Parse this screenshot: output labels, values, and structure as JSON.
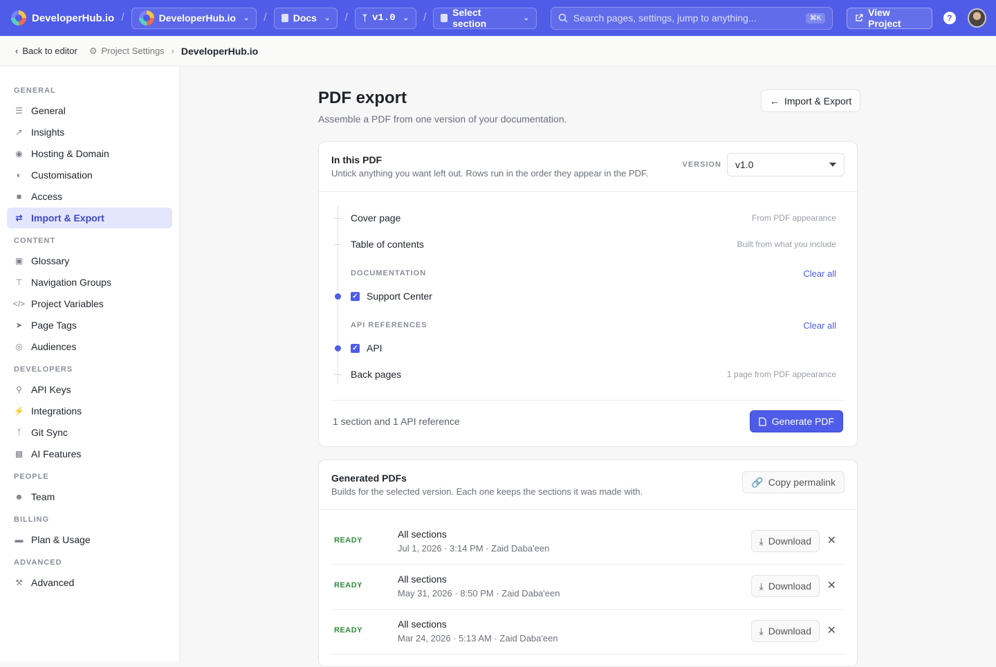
{
  "topbar": {
    "brand": "DeveloperHub.io",
    "project": "DeveloperHub.io",
    "docs": "Docs",
    "version": "v1.0",
    "section": "Select section",
    "search_placeholder": "Search pages, settings, jump to anything...",
    "search_shortcut": "⌘K",
    "view_project": "View Project",
    "help": "?"
  },
  "breadcrumb": {
    "back": "Back to editor",
    "settings": "Project Settings",
    "current": "DeveloperHub.io"
  },
  "sidebar": {
    "groups": [
      {
        "title": "GENERAL",
        "items": [
          "General",
          "Insights",
          "Hosting & Domain",
          "Customisation",
          "Access",
          "Import & Export"
        ]
      },
      {
        "title": "CONTENT",
        "items": [
          "Glossary",
          "Navigation Groups",
          "Project Variables",
          "Page Tags",
          "Audiences"
        ]
      },
      {
        "title": "DEVELOPERS",
        "items": [
          "API Keys",
          "Integrations",
          "Git Sync",
          "AI Features"
        ]
      },
      {
        "title": "PEOPLE",
        "items": [
          "Team"
        ]
      },
      {
        "title": "BILLING",
        "items": [
          "Plan & Usage"
        ]
      },
      {
        "title": "ADVANCED",
        "items": [
          "Advanced"
        ]
      }
    ],
    "active": "Import & Export"
  },
  "page": {
    "title": "PDF export",
    "subtitle": "Assemble a PDF from one version of your documentation.",
    "back_button": "Import & Export"
  },
  "in_pdf": {
    "title": "In this PDF",
    "description": "Untick anything you want left out. Rows run in the order they appear in the PDF.",
    "version_label": "VERSION",
    "version_value": "v1.0",
    "cover_page": "Cover page",
    "cover_note": "From PDF appearance",
    "toc": "Table of contents",
    "toc_note": "Built from what you include",
    "documentation_label": "DOCUMENTATION",
    "clear_all": "Clear all",
    "doc_item": "Support Center",
    "api_label": "API REFERENCES",
    "api_item": "API",
    "back_pages": "Back pages",
    "back_note": "1 page from PDF appearance",
    "summary": "1 section and 1 API reference",
    "generate": "Generate PDF"
  },
  "generated": {
    "title": "Generated PDFs",
    "description": "Builds for the selected version. Each one keeps the sections it was made with.",
    "permalink": "Copy permalink",
    "download": "Download",
    "rows": [
      {
        "status": "READY",
        "title": "All sections",
        "meta": "Jul 1, 2026 · 3:14 PM · Zaid Daba'een"
      },
      {
        "status": "READY",
        "title": "All sections",
        "meta": "May 31, 2026 · 8:50 PM · Zaid Daba'een"
      },
      {
        "status": "READY",
        "title": "All sections",
        "meta": "Mar 24, 2026 · 5:13 AM · Zaid Daba'een"
      }
    ]
  },
  "colors": {
    "accent": "#4f5ce8",
    "ready": "#2e8b3a"
  }
}
